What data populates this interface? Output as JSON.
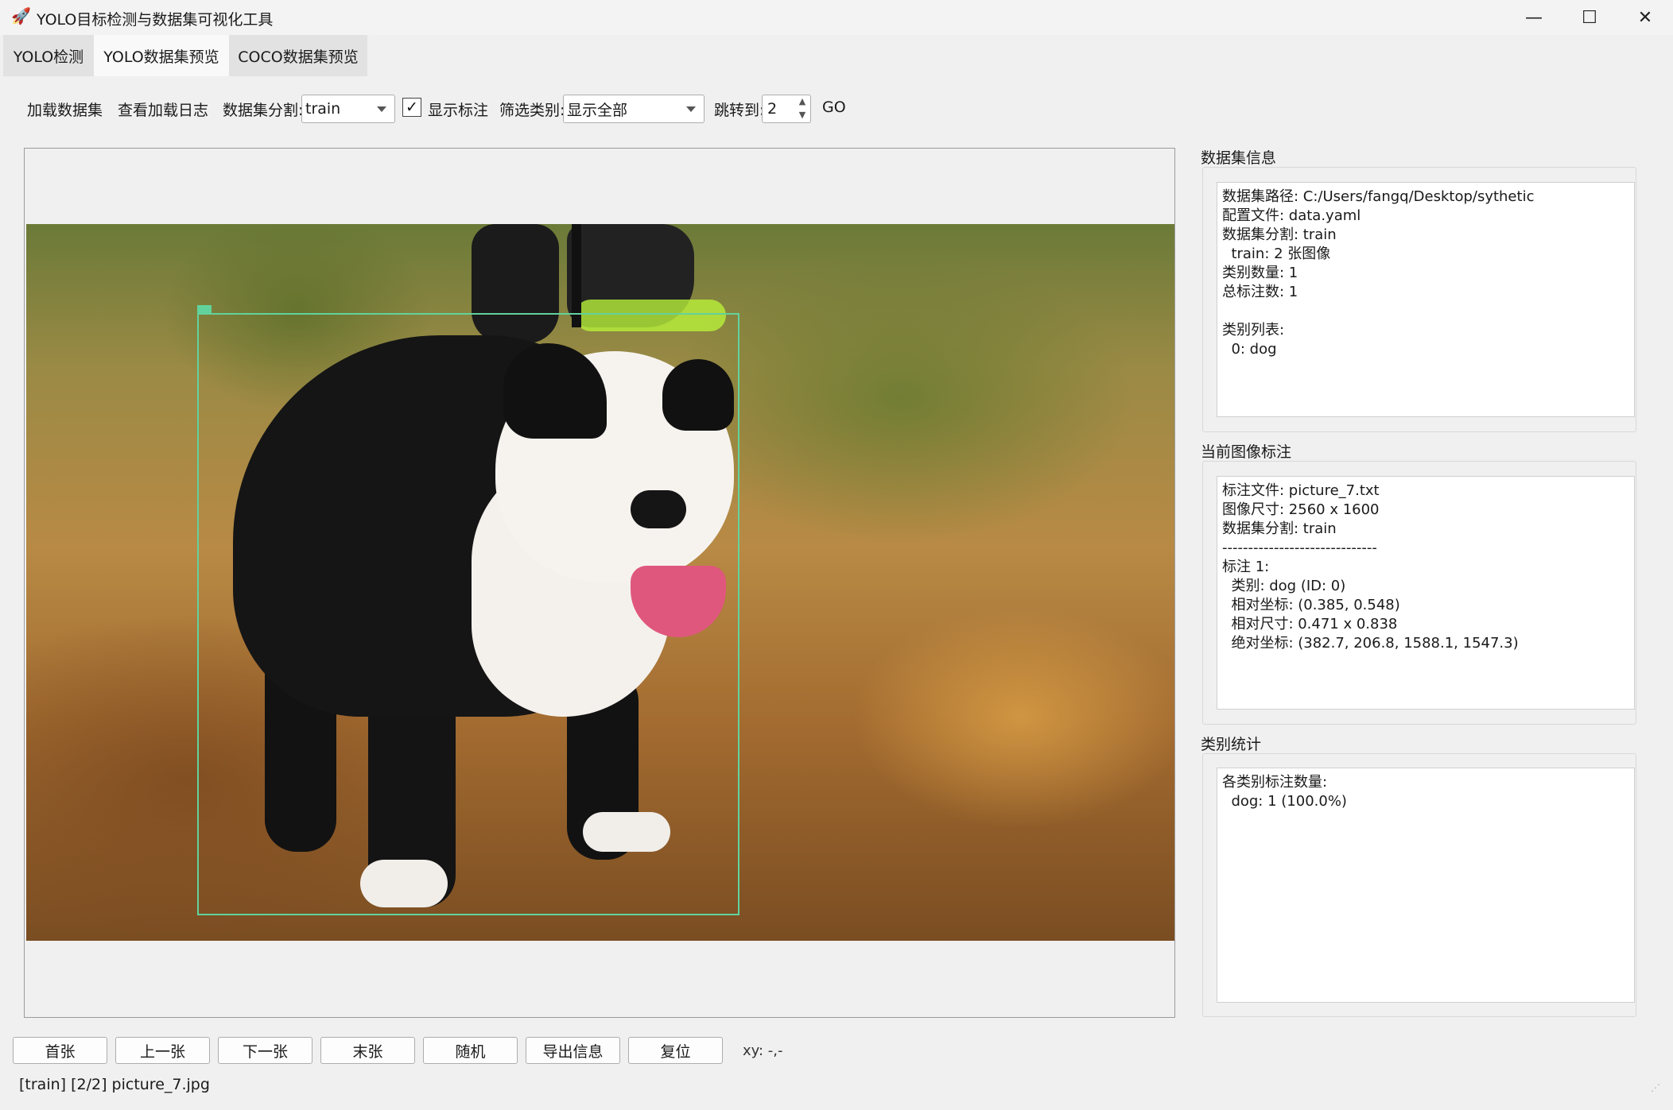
{
  "window": {
    "title": "YOLO目标检测与数据集可视化工具",
    "minimize_glyph": "—",
    "maximize_glyph": "☐",
    "close_glyph": "✕",
    "app_icon": "rocket-icon"
  },
  "tabs": [
    {
      "label": "YOLO检测"
    },
    {
      "label": "YOLO数据集预览"
    },
    {
      "label": "COCO数据集预览"
    }
  ],
  "toolbar": {
    "load_dataset": "加载数据集",
    "view_log": "查看加载日志",
    "split_label": "数据集分割:",
    "split_value": "train",
    "show_annotations_checked": "✓",
    "show_annotations_label": "显示标注",
    "filter_label": "筛选类别:",
    "filter_value": "显示全部",
    "jump_label": "跳转到:",
    "jump_value": "2",
    "go_label": "GO"
  },
  "image": {
    "annotation_label": "dog"
  },
  "nav_buttons": {
    "first": "首张",
    "prev": "上一张",
    "next": "下一张",
    "last": "末张",
    "random": "随机",
    "export": "导出信息",
    "reset": "复位"
  },
  "xy_readout": "xy: -,-",
  "status": "[train] [2/2] picture_7.jpg",
  "panels": {
    "dataset_info": {
      "title": "数据集信息",
      "lines": [
        "数据集路径: C:/Users/fangq/Desktop/sythetic",
        "配置文件: data.yaml",
        "数据集分割: train",
        "  train: 2 张图像",
        "类别数量: 1",
        "总标注数: 1",
        "",
        "类别列表:",
        "  0: dog"
      ]
    },
    "current_annotation": {
      "title": "当前图像标注",
      "lines": [
        "标注文件: picture_7.txt",
        "图像尺寸: 2560 x 1600",
        "数据集分割: train",
        "------------------------------",
        "标注 1:",
        "  类别: dog (ID: 0)",
        "  相对坐标: (0.385, 0.548)",
        "  相对尺寸: 0.471 x 0.838",
        "  绝对坐标: (382.7, 206.8, 1588.1, 1547.3)"
      ]
    },
    "class_stats": {
      "title": "类别统计",
      "lines": [
        "各类别标注数量:",
        "  dog: 1 (100.0%)"
      ]
    }
  },
  "colors": {
    "bbox": "#62d29c",
    "active_tab": "#f9f9f9"
  }
}
